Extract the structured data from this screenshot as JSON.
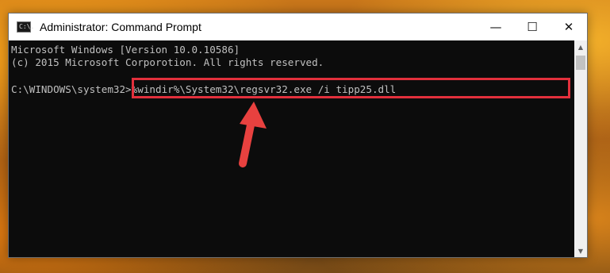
{
  "window": {
    "title": "Administrator: Command Prompt",
    "icon": "cmd-icon",
    "icon_text": "C:\\.",
    "controls": {
      "minimize": "—",
      "maximize": "☐",
      "close": "✕"
    }
  },
  "console": {
    "lines": [
      "Microsoft Windows [Version 10.0.10586]",
      "(c) 2015 Microsoft Corporotion. All rights reserved."
    ],
    "prompt": "C:\\WINDOWS\\system32>",
    "command": "%windir%\\System32\\regsvr32.exe /i tipp25.dll"
  },
  "scrollbar": {
    "up": "▲",
    "down": "▼"
  },
  "annotation": {
    "highlight_color": "#e2303c",
    "arrow_color": "#e8413f"
  }
}
